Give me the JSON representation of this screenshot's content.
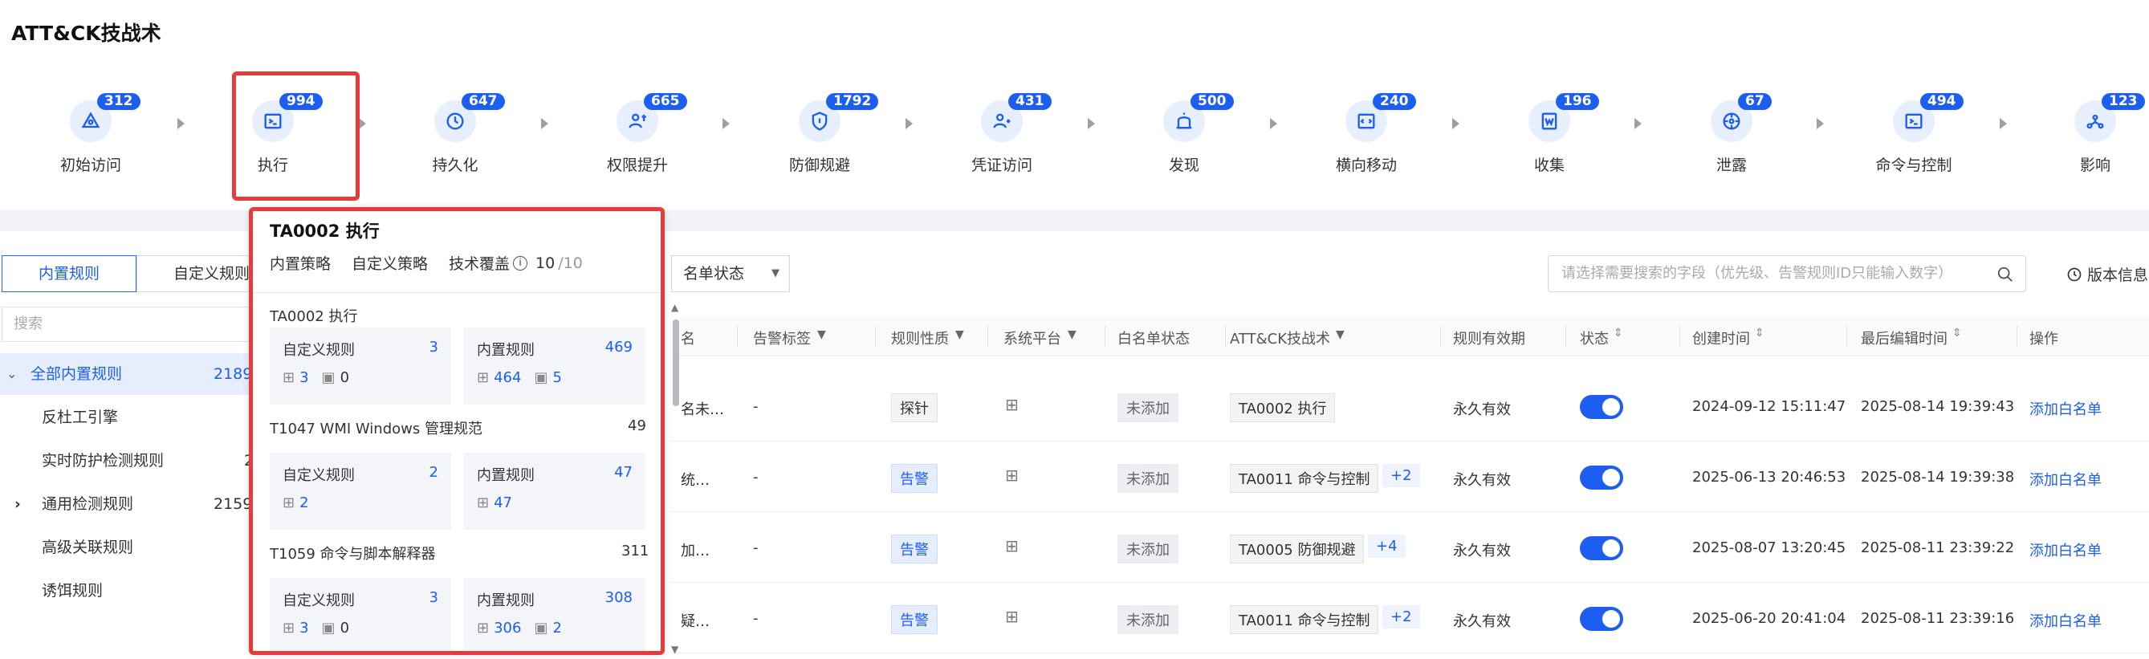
{
  "page_title": "ATT&CK技战术",
  "tactics": [
    {
      "label": "初始访问",
      "count": "312",
      "icon": "initial-access-icon"
    },
    {
      "label": "执行",
      "count": "994",
      "icon": "execution-icon"
    },
    {
      "label": "持久化",
      "count": "647",
      "icon": "persistence-icon"
    },
    {
      "label": "权限提升",
      "count": "665",
      "icon": "privilege-escalation-icon"
    },
    {
      "label": "防御规避",
      "count": "1792",
      "icon": "defense-evasion-icon"
    },
    {
      "label": "凭证访问",
      "count": "431",
      "icon": "credential-access-icon"
    },
    {
      "label": "发现",
      "count": "500",
      "icon": "discovery-icon"
    },
    {
      "label": "横向移动",
      "count": "240",
      "icon": "lateral-movement-icon"
    },
    {
      "label": "收集",
      "count": "196",
      "icon": "collection-icon"
    },
    {
      "label": "泄露",
      "count": "67",
      "icon": "exfiltration-icon"
    },
    {
      "label": "命令与控制",
      "count": "494",
      "icon": "command-control-icon"
    },
    {
      "label": "影响",
      "count": "123",
      "icon": "impact-icon"
    }
  ],
  "tabs": {
    "builtin": "内置规则",
    "custom": "自定义规则"
  },
  "search_placeholder": "搜索",
  "tree": [
    {
      "label": "全部内置规则",
      "count": "2189"
    },
    {
      "label": "反杜工引擎",
      "count": ""
    },
    {
      "label": "实时防护检测规则",
      "count": "2"
    },
    {
      "label": "通用检测规则",
      "count": "2159"
    },
    {
      "label": "高级关联规则",
      "count": ""
    },
    {
      "label": "诱饵规则",
      "count": ""
    }
  ],
  "popup": {
    "title": "TA0002 执行",
    "builtin_policy": "内置策略",
    "custom_policy": "自定义策略",
    "coverage_label": "技术覆盖",
    "coverage_done": "10",
    "coverage_total": "/10",
    "techniques": [
      {
        "name": "TA0002 执行",
        "total": "",
        "custom_label": "自定义规则",
        "custom_count": "3",
        "custom_win": "3",
        "custom_linux": "0",
        "builtin_label": "内置规则",
        "builtin_count": "469",
        "builtin_win": "464",
        "builtin_linux": "5"
      },
      {
        "name": "T1047 WMI Windows 管理规范",
        "total": "49",
        "custom_label": "自定义规则",
        "custom_count": "2",
        "custom_win": "2",
        "custom_linux": "",
        "builtin_label": "内置规则",
        "builtin_count": "47",
        "builtin_win": "47",
        "builtin_linux": ""
      },
      {
        "name": "T1059 命令与脚本解释器",
        "total": "311",
        "custom_label": "自定义规则",
        "custom_count": "3",
        "custom_win": "3",
        "custom_linux": "0",
        "builtin_label": "内置规则",
        "builtin_count": "308",
        "builtin_win": "306",
        "builtin_linux": "2"
      }
    ]
  },
  "filter_label": "名单状态",
  "global_search_placeholder": "请选择需要搜索的字段（优先级、告警规则ID只能输入数字）",
  "version_label": "版本信息",
  "columns": [
    "名",
    "告警标签",
    "规则性质",
    "系统平台",
    "白名单状态",
    "ATT&CK技战术",
    "规则有效期",
    "状态",
    "创建时间",
    "最后编辑时间",
    "操作"
  ],
  "rows": [
    {
      "name": "名未…",
      "tag": "-",
      "nature": "探针",
      "whitelist": "未添加",
      "tactic": "TA0002 执行",
      "extra": "",
      "validity": "永久有效",
      "created": "2024-09-12 15:11:47",
      "edited": "2025-08-14 19:39:43",
      "action": "添加白名单"
    },
    {
      "name": "统…",
      "tag": "-",
      "nature": "告警",
      "whitelist": "未添加",
      "tactic": "TA0011 命令与控制",
      "extra": "+2",
      "validity": "永久有效",
      "created": "2025-06-13 20:46:53",
      "edited": "2025-08-14 19:39:38",
      "action": "添加白名单"
    },
    {
      "name": "加…",
      "tag": "-",
      "nature": "告警",
      "whitelist": "未添加",
      "tactic": "TA0005 防御规避",
      "extra": "+4",
      "validity": "永久有效",
      "created": "2025-08-07 13:20:45",
      "edited": "2025-08-11 23:39:22",
      "action": "添加白名单"
    },
    {
      "name": "疑…",
      "tag": "-",
      "nature": "告警",
      "whitelist": "未添加",
      "tactic": "TA0011 命令与控制",
      "extra": "+2",
      "validity": "永久有效",
      "created": "2025-06-20 20:41:04",
      "edited": "2025-08-11 23:39:16",
      "action": "添加白名单"
    }
  ]
}
